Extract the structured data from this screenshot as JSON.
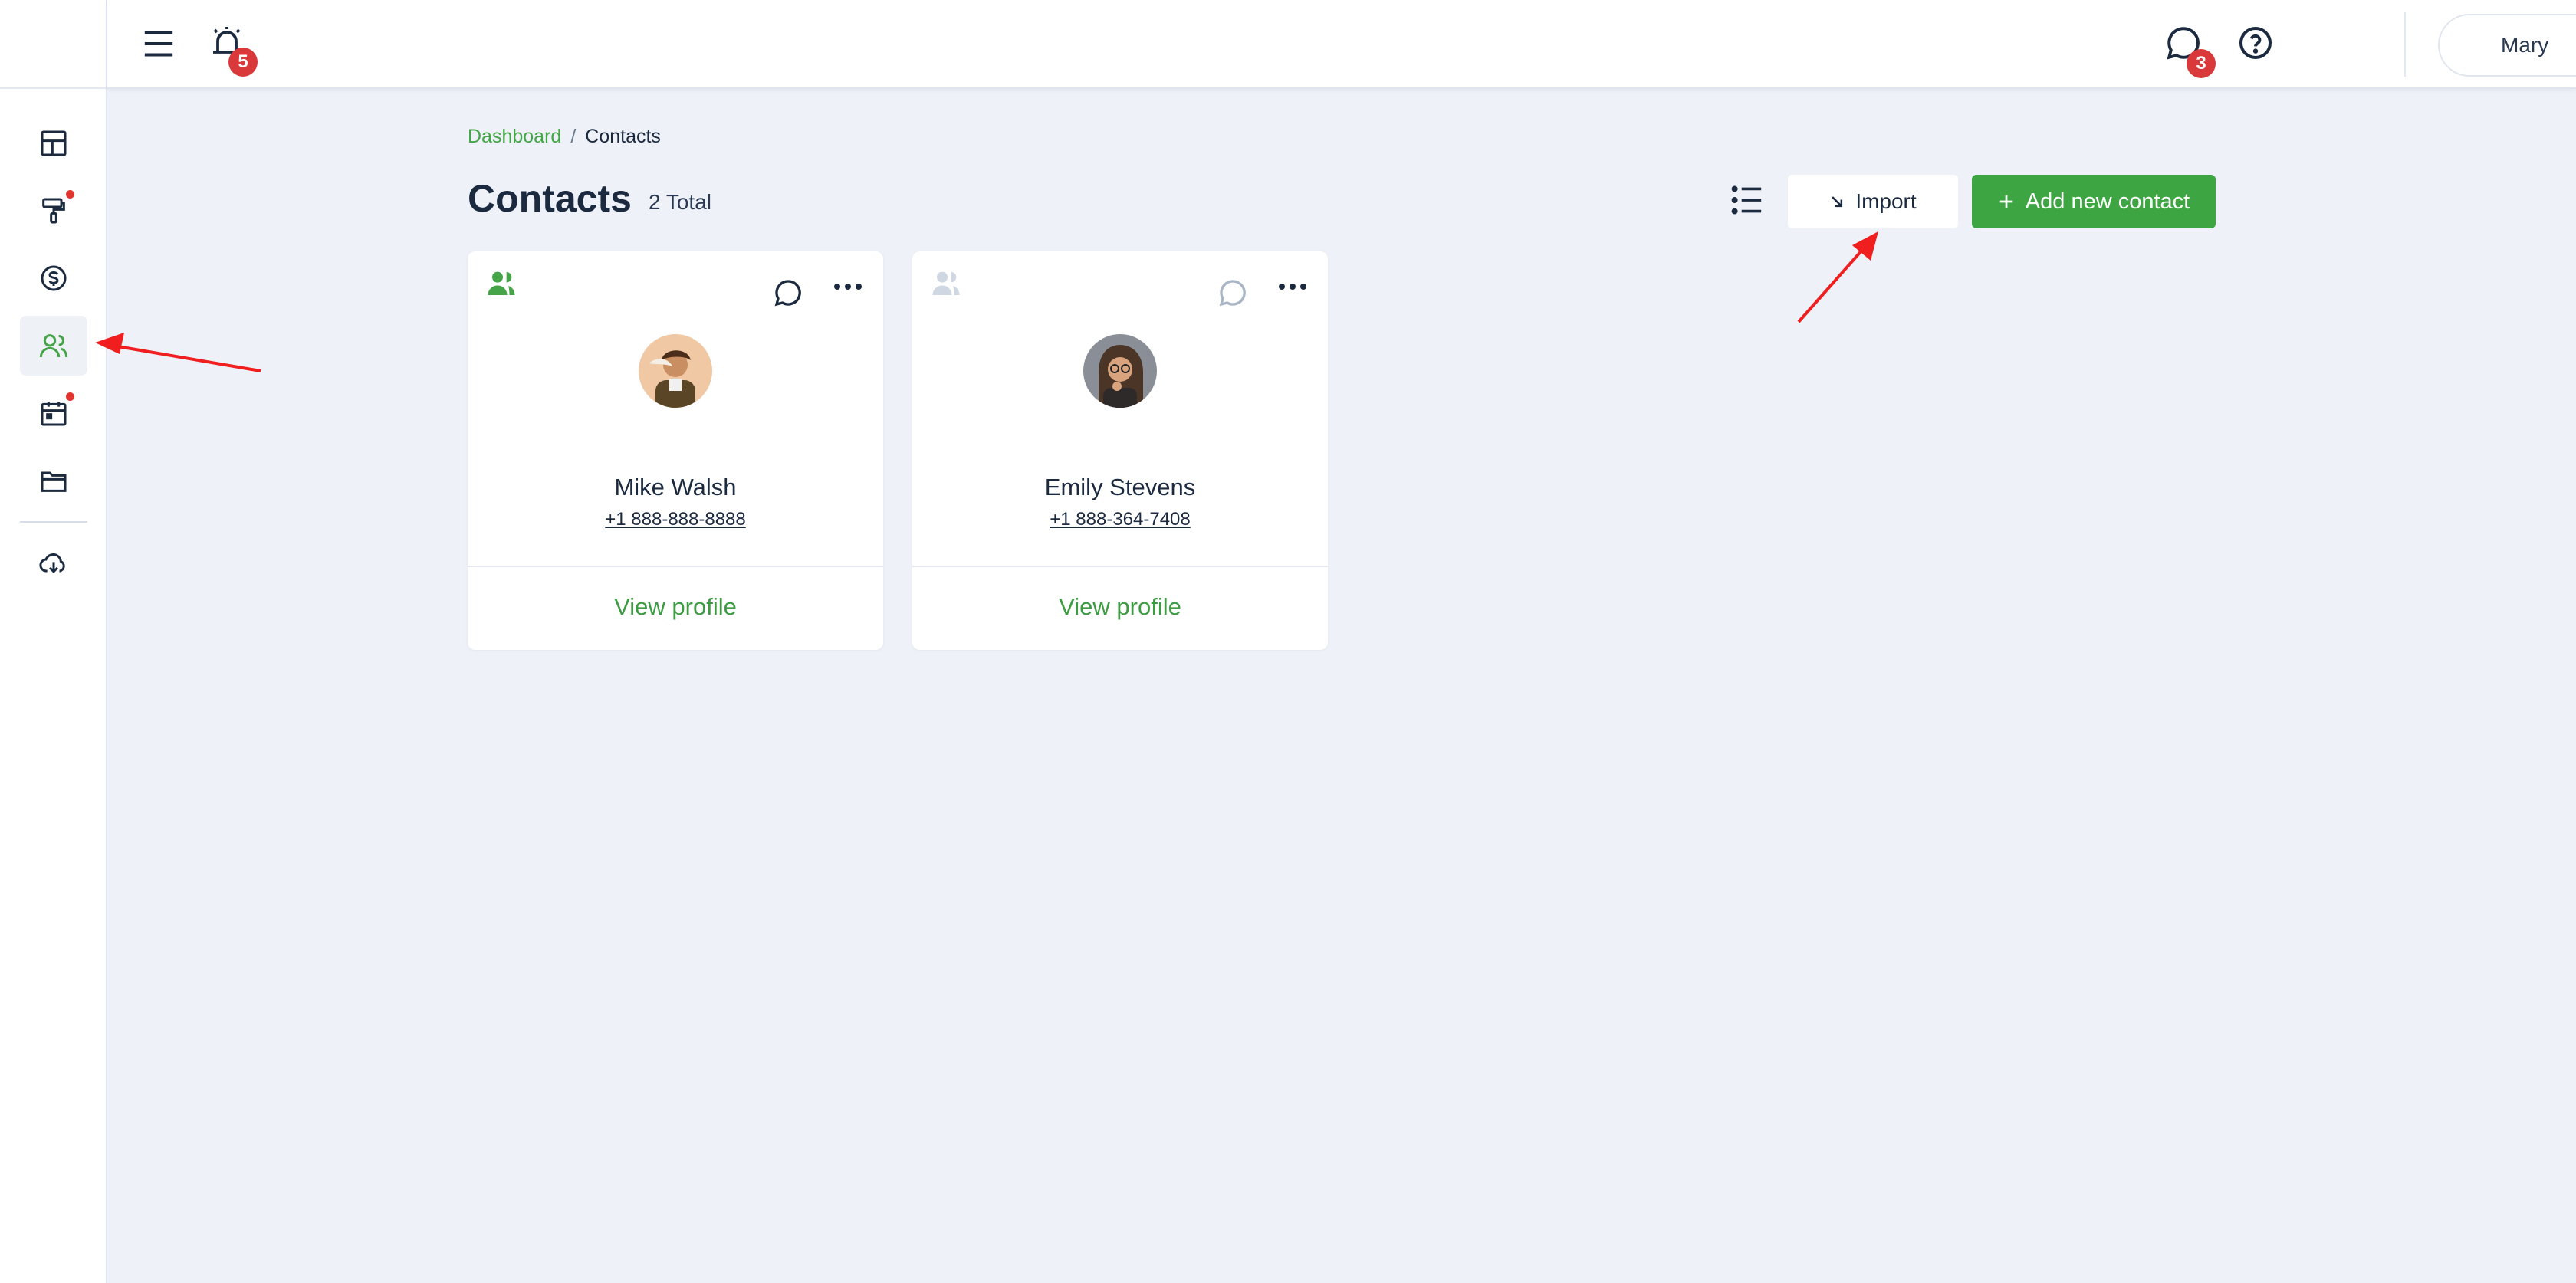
{
  "header": {
    "notifications_count": "5",
    "messages_count": "3",
    "user_name": "Mary"
  },
  "breadcrumb": {
    "items": [
      "Dashboard",
      "Contacts"
    ],
    "separator": "/"
  },
  "page": {
    "title": "Contacts",
    "total_label": "2 Total"
  },
  "actions": {
    "import_label": "Import",
    "add_label": "Add new contact"
  },
  "contacts": [
    {
      "name": "Mike Walsh",
      "phone": "+1 888-888-8888",
      "view_label": "View profile",
      "type_icon_color": "#45a447"
    },
    {
      "name": "Emily Stevens",
      "phone": "+1 888-364-7408",
      "view_label": "View profile",
      "type_icon_color": "#cbd5e1"
    }
  ],
  "sidebar": {
    "items": [
      "dashboard-icon",
      "paint-roller-icon",
      "dollar-icon",
      "contacts-icon",
      "calendar-icon",
      "folder-icon",
      "cloud-download-icon"
    ],
    "active": "contacts-icon"
  },
  "colors": {
    "accent": "#3da542",
    "badge": "#d9393b",
    "background": "#eef2f8"
  }
}
